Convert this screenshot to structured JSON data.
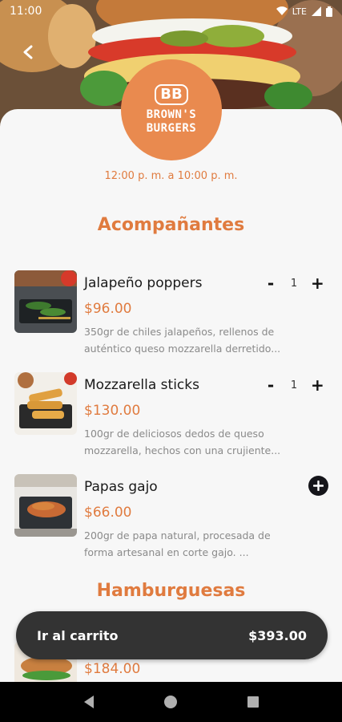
{
  "status_bar": {
    "time": "11:00",
    "network": "LTE"
  },
  "restaurant": {
    "logo_mark": "BB",
    "logo_name_line1": "BROWN'S",
    "logo_name_line2": "BURGERS",
    "hours": "12:00 p. m. a 10:00 p. m."
  },
  "sections": [
    {
      "title": "Acompañantes",
      "items": [
        {
          "name": "Jalapeño poppers",
          "price": "$96.00",
          "desc_line1": "350gr de chiles jalapeños, rellenos de",
          "desc_line2": "auténtico queso mozzarella derretido...",
          "qty": "1"
        },
        {
          "name": "Mozzarella sticks",
          "price": "$130.00",
          "desc_line1": "100gr de deliciosos dedos de queso",
          "desc_line2": "mozzarella, hechos con una crujiente...",
          "qty": "1"
        },
        {
          "name": "Papas gajo",
          "price": "$66.00",
          "desc_line1": "200gr de papa natural, procesada de",
          "desc_line2": "forma artesanal en corte gajo. ..."
        }
      ]
    },
    {
      "title": "Hamburguesas",
      "items": [
        {
          "price": "$184.00"
        }
      ]
    }
  ],
  "qty_controls": {
    "minus": "-",
    "plus": "+"
  },
  "cart": {
    "label": "Ir al carrito",
    "total": "$393.00"
  },
  "colors": {
    "accent": "#e07b3f",
    "logo_bg": "#e98a4f",
    "cart_bg": "#333333"
  },
  "icons": [
    "back-arrow-icon",
    "wifi-icon",
    "signal-icon",
    "battery-icon",
    "plus-icon",
    "nav-back-icon",
    "nav-home-icon",
    "nav-recents-icon"
  ]
}
